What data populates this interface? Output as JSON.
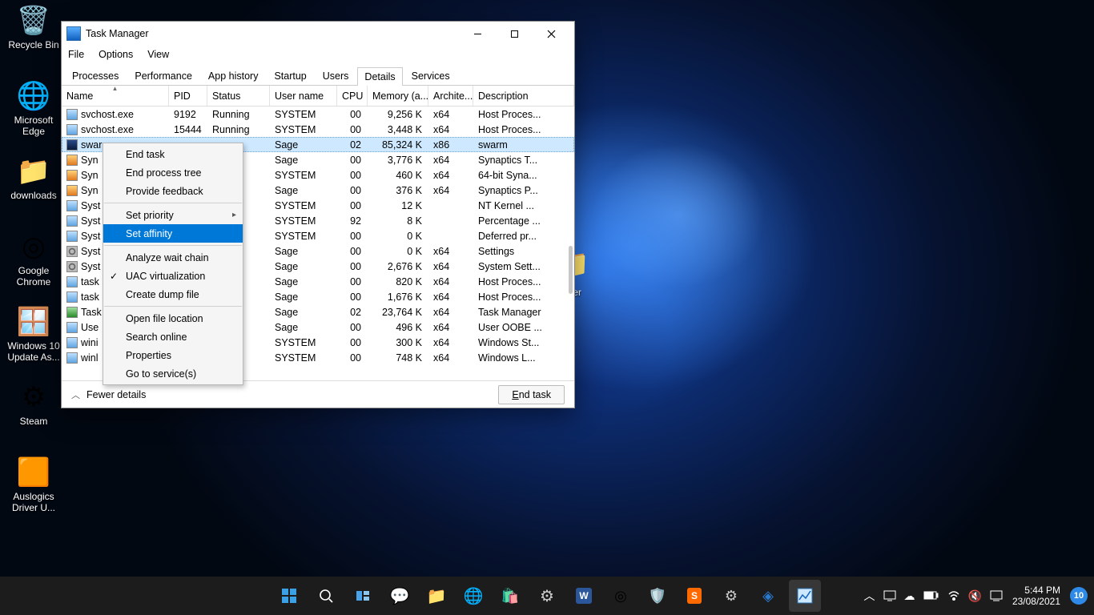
{
  "desktop": {
    "icons": [
      {
        "label": "Recycle Bin",
        "glyph": "🗑️"
      },
      {
        "label": "Microsoft Edge",
        "glyph": "🌐"
      },
      {
        "label": "downloads",
        "glyph": "📁"
      },
      {
        "label": "Google Chrome",
        "glyph": "◎"
      },
      {
        "label": "Windows 10 Update As...",
        "glyph": "🪟"
      },
      {
        "label": "Steam",
        "glyph": "⚙"
      },
      {
        "label": "Auslogics Driver U...",
        "glyph": "🟧"
      }
    ],
    "hidden_folder_label": "older"
  },
  "window": {
    "title": "Task Manager",
    "menus": [
      "File",
      "Options",
      "View"
    ],
    "tabs": [
      "Processes",
      "Performance",
      "App history",
      "Startup",
      "Users",
      "Details",
      "Services"
    ],
    "active_tab": "Details",
    "columns": [
      "Name",
      "PID",
      "Status",
      "User name",
      "CPU",
      "Memory (a...",
      "Archite...",
      "Description"
    ],
    "footer_link": "Fewer details",
    "end_task_label": "End task"
  },
  "rows": [
    {
      "name": "svchost.exe",
      "pid": "9192",
      "status": "Running",
      "user": "SYSTEM",
      "cpu": "00",
      "mem": "9,256 K",
      "arch": "x64",
      "desc": "Host Proces...",
      "icon": "blue"
    },
    {
      "name": "svchost.exe",
      "pid": "15444",
      "status": "Running",
      "user": "SYSTEM",
      "cpu": "00",
      "mem": "3,448 K",
      "arch": "x64",
      "desc": "Host Proces...",
      "icon": "blue"
    },
    {
      "name": "swar",
      "pid": "",
      "status": "g",
      "user": "Sage",
      "cpu": "02",
      "mem": "85,324 K",
      "arch": "x86",
      "desc": "swarm",
      "icon": "dark",
      "selected": true
    },
    {
      "name": "Syn",
      "pid": "",
      "status": "g",
      "user": "Sage",
      "cpu": "00",
      "mem": "3,776 K",
      "arch": "x64",
      "desc": "Synaptics T...",
      "icon": "orange"
    },
    {
      "name": "Syn",
      "pid": "",
      "status": "g",
      "user": "SYSTEM",
      "cpu": "00",
      "mem": "460 K",
      "arch": "x64",
      "desc": "64-bit Syna...",
      "icon": "orange"
    },
    {
      "name": "Syn",
      "pid": "",
      "status": "g",
      "user": "Sage",
      "cpu": "00",
      "mem": "376 K",
      "arch": "x64",
      "desc": "Synaptics P...",
      "icon": "orange"
    },
    {
      "name": "Syst",
      "pid": "",
      "status": "g",
      "user": "SYSTEM",
      "cpu": "00",
      "mem": "12 K",
      "arch": "",
      "desc": "NT Kernel ...",
      "icon": "blue"
    },
    {
      "name": "Syst",
      "pid": "",
      "status": "g",
      "user": "SYSTEM",
      "cpu": "92",
      "mem": "8 K",
      "arch": "",
      "desc": "Percentage ...",
      "icon": "blue"
    },
    {
      "name": "Syst",
      "pid": "",
      "status": "g",
      "user": "SYSTEM",
      "cpu": "00",
      "mem": "0 K",
      "arch": "",
      "desc": "Deferred pr...",
      "icon": "blue"
    },
    {
      "name": "Syst",
      "pid": "",
      "status": "ded",
      "user": "Sage",
      "cpu": "00",
      "mem": "0 K",
      "arch": "x64",
      "desc": "Settings",
      "icon": "gear"
    },
    {
      "name": "Syst",
      "pid": "",
      "status": "g",
      "user": "Sage",
      "cpu": "00",
      "mem": "2,676 K",
      "arch": "x64",
      "desc": "System Sett...",
      "icon": "gear"
    },
    {
      "name": "task",
      "pid": "",
      "status": "g",
      "user": "Sage",
      "cpu": "00",
      "mem": "820 K",
      "arch": "x64",
      "desc": "Host Proces...",
      "icon": "blue"
    },
    {
      "name": "task",
      "pid": "",
      "status": "g",
      "user": "Sage",
      "cpu": "00",
      "mem": "1,676 K",
      "arch": "x64",
      "desc": "Host Proces...",
      "icon": "blue"
    },
    {
      "name": "Task",
      "pid": "",
      "status": "g",
      "user": "Sage",
      "cpu": "02",
      "mem": "23,764 K",
      "arch": "x64",
      "desc": "Task Manager",
      "icon": "green"
    },
    {
      "name": "Use",
      "pid": "",
      "status": "g",
      "user": "Sage",
      "cpu": "00",
      "mem": "496 K",
      "arch": "x64",
      "desc": "User OOBE ...",
      "icon": "blue"
    },
    {
      "name": "wini",
      "pid": "",
      "status": "g",
      "user": "SYSTEM",
      "cpu": "00",
      "mem": "300 K",
      "arch": "x64",
      "desc": "Windows St...",
      "icon": "blue"
    },
    {
      "name": "winl",
      "pid": "",
      "status": "g",
      "user": "SYSTEM",
      "cpu": "00",
      "mem": "748 K",
      "arch": "x64",
      "desc": "Windows L...",
      "icon": "blue"
    }
  ],
  "context_menu": {
    "items": [
      {
        "label": "End task"
      },
      {
        "label": "End process tree"
      },
      {
        "label": "Provide feedback"
      },
      {
        "sep": true
      },
      {
        "label": "Set priority",
        "submenu": true
      },
      {
        "label": "Set affinity",
        "highlight": true
      },
      {
        "sep": true
      },
      {
        "label": "Analyze wait chain"
      },
      {
        "label": "UAC virtualization",
        "checked": true
      },
      {
        "label": "Create dump file"
      },
      {
        "sep": true
      },
      {
        "label": "Open file location"
      },
      {
        "label": "Search online"
      },
      {
        "label": "Properties"
      },
      {
        "label": "Go to service(s)"
      }
    ]
  },
  "taskbar": {
    "time": "5:44 PM",
    "date": "23/08/2021",
    "noti_count": "10",
    "tray_icons": [
      "expand",
      "tablet",
      "cloud",
      "battery",
      "wifi",
      "volume",
      "lang"
    ]
  }
}
